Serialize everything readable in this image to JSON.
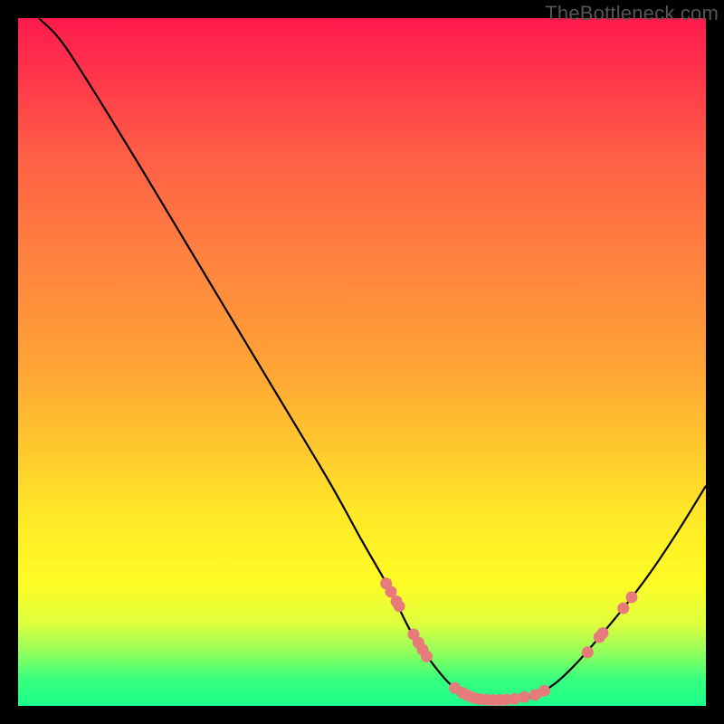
{
  "watermark": "TheBottleneck.com",
  "colors": {
    "background": "#000000",
    "gradient_top": "#ff1a4d",
    "gradient_mid1": "#ff823f",
    "gradient_mid2": "#ffe827",
    "gradient_bottom": "#1aff8b",
    "curve": "#000000",
    "markers": "#e77b7b"
  },
  "chart_data": {
    "type": "line",
    "title": "",
    "xlabel": "",
    "ylabel": "",
    "xlim": [
      0,
      100
    ],
    "ylim": [
      0,
      100
    ],
    "curve": [
      {
        "x": 3,
        "y": 100
      },
      {
        "x": 6,
        "y": 97
      },
      {
        "x": 10,
        "y": 91
      },
      {
        "x": 18,
        "y": 78
      },
      {
        "x": 27,
        "y": 63
      },
      {
        "x": 36,
        "y": 48
      },
      {
        "x": 45,
        "y": 33
      },
      {
        "x": 50,
        "y": 24
      },
      {
        "x": 54,
        "y": 17
      },
      {
        "x": 57,
        "y": 11
      },
      {
        "x": 60,
        "y": 6.5
      },
      {
        "x": 63,
        "y": 3.0
      },
      {
        "x": 66,
        "y": 1.4
      },
      {
        "x": 69,
        "y": 0.8
      },
      {
        "x": 72,
        "y": 0.8
      },
      {
        "x": 75,
        "y": 1.4
      },
      {
        "x": 78,
        "y": 3.2
      },
      {
        "x": 81,
        "y": 6.0
      },
      {
        "x": 84,
        "y": 9.4
      },
      {
        "x": 88,
        "y": 14.2
      },
      {
        "x": 92,
        "y": 19.5
      },
      {
        "x": 96,
        "y": 25.5
      },
      {
        "x": 100,
        "y": 32
      }
    ],
    "markers": [
      {
        "x": 53.5,
        "y": 17.8
      },
      {
        "x": 54.2,
        "y": 16.6
      },
      {
        "x": 55.0,
        "y": 15.2
      },
      {
        "x": 55.4,
        "y": 14.5
      },
      {
        "x": 57.5,
        "y": 10.4
      },
      {
        "x": 58.2,
        "y": 9.2
      },
      {
        "x": 58.8,
        "y": 8.2
      },
      {
        "x": 59.4,
        "y": 7.2
      },
      {
        "x": 63.5,
        "y": 2.6
      },
      {
        "x": 64.6,
        "y": 1.9
      },
      {
        "x": 65.4,
        "y": 1.5
      },
      {
        "x": 66.2,
        "y": 1.2
      },
      {
        "x": 67.0,
        "y": 1.0
      },
      {
        "x": 68.0,
        "y": 0.9
      },
      {
        "x": 69.0,
        "y": 0.85
      },
      {
        "x": 70.0,
        "y": 0.85
      },
      {
        "x": 71.0,
        "y": 0.9
      },
      {
        "x": 72.2,
        "y": 1.0
      },
      {
        "x": 73.6,
        "y": 1.3
      },
      {
        "x": 75.2,
        "y": 1.6
      },
      {
        "x": 76.5,
        "y": 2.2
      },
      {
        "x": 82.8,
        "y": 7.8
      },
      {
        "x": 84.5,
        "y": 10.0
      },
      {
        "x": 85.0,
        "y": 10.6
      },
      {
        "x": 88.0,
        "y": 14.2
      },
      {
        "x": 89.2,
        "y": 15.8
      }
    ]
  }
}
